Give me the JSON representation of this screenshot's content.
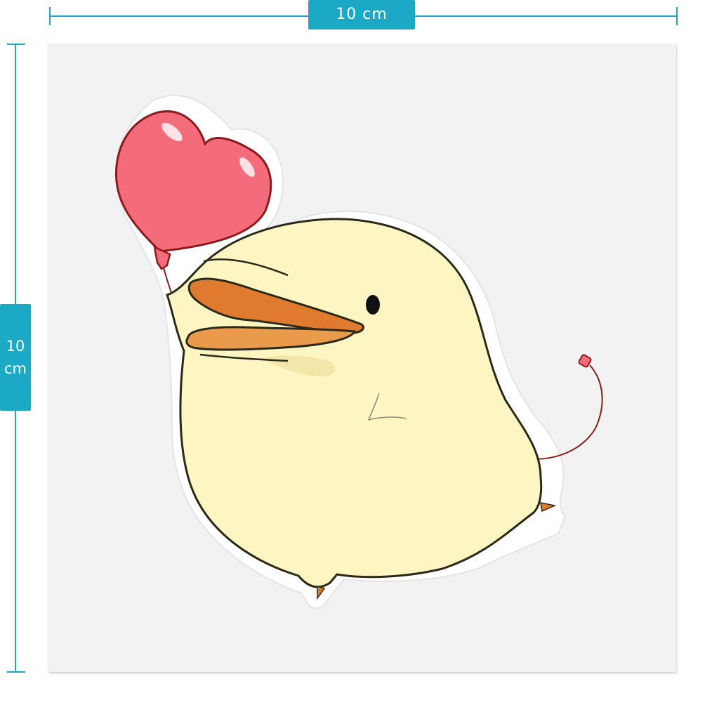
{
  "dimensions": {
    "width_label": "10 cm",
    "height_value": "10",
    "height_unit": "cm"
  },
  "colors": {
    "accent": "#1ba9c6",
    "sheet": "#f2f2f2",
    "duck_body": "#fdf5c2",
    "beak": "#e07a2e",
    "balloon": "#f46c7c",
    "string": "#8b1a1a"
  },
  "sticker": {
    "subject": "duck-with-heart-balloon-icon"
  }
}
